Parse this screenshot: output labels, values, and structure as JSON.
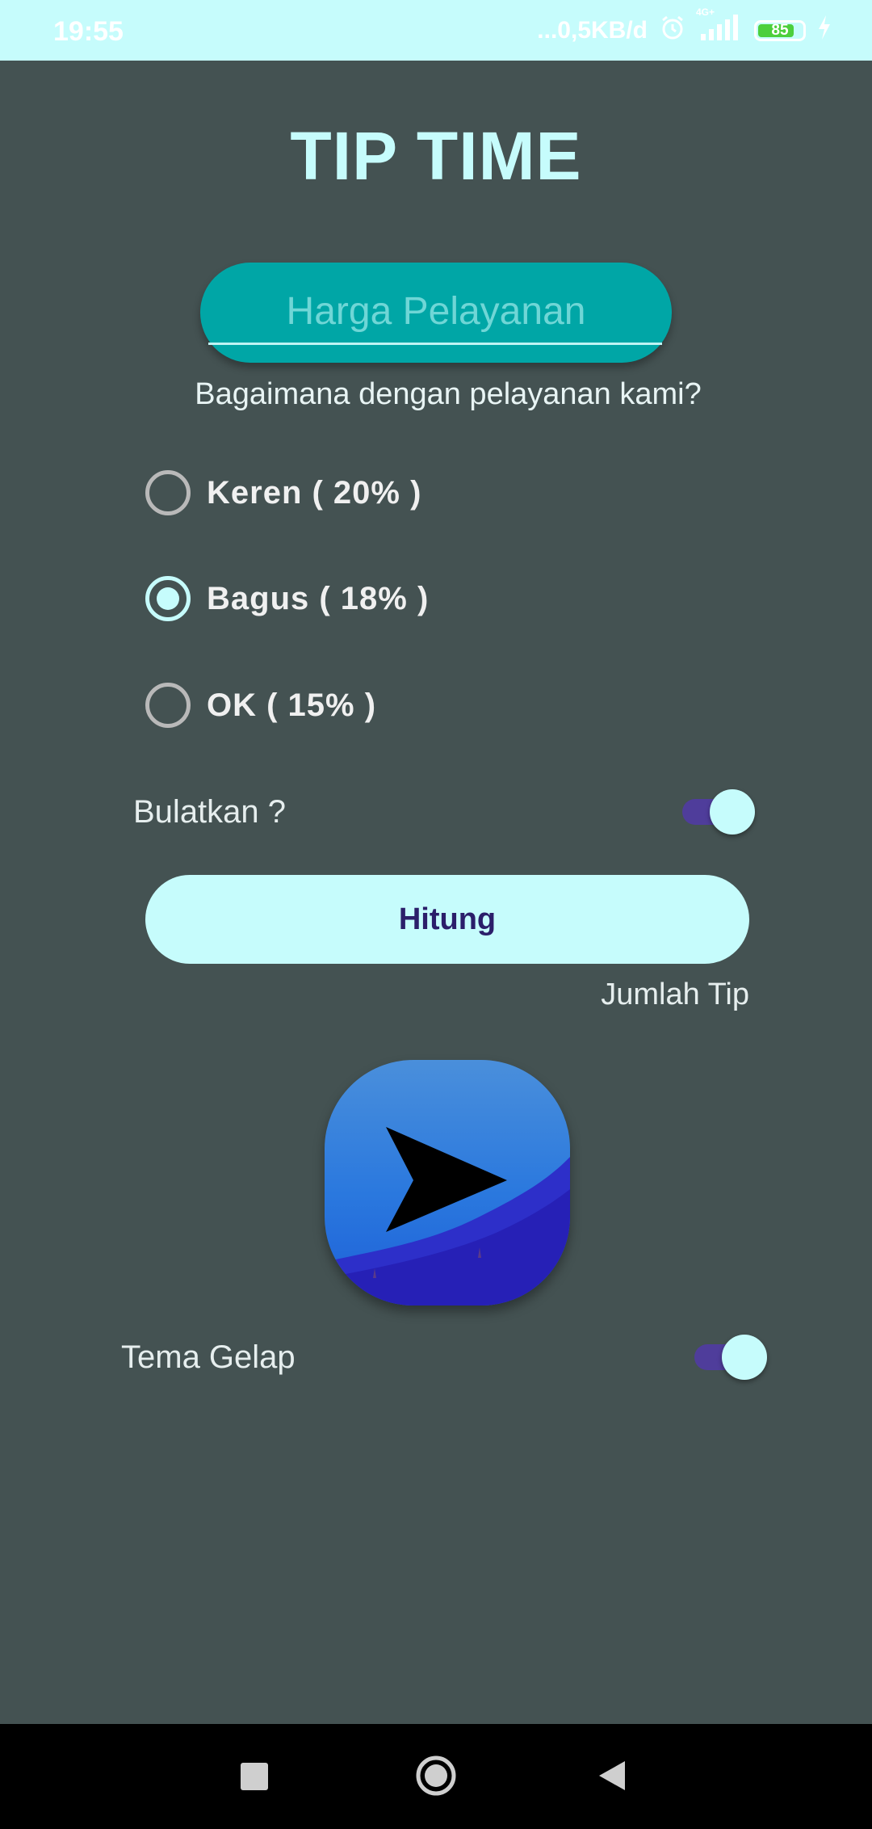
{
  "status_bar": {
    "time": "19:55",
    "network_speed": "...0,5KB/d",
    "battery": "85",
    "network_type": "4G+"
  },
  "app": {
    "title": "TIP TIME",
    "cost_input": {
      "placeholder": "Harga Pelayanan",
      "value": ""
    },
    "question": "Bagaimana dengan pelayanan kami?",
    "options": [
      {
        "label": "Keren ( 20% )",
        "selected": false
      },
      {
        "label": "Bagus ( 18% )",
        "selected": true
      },
      {
        "label": "OK ( 15% )",
        "selected": false
      }
    ],
    "round_up": {
      "label": "Bulatkan ?",
      "on": true
    },
    "calculate_button": "Hitung",
    "tip_amount_label": "Jumlah Tip",
    "dark_theme": {
      "label": "Tema Gelap",
      "on": true
    }
  },
  "colors": {
    "background": "#445252",
    "accent": "#c6fcfc",
    "input_bg": "#00a6a6",
    "switch_track": "#4f3d9b",
    "button_text": "#2b1e6a"
  },
  "icons": {
    "app_icon": "send-arrow-icon",
    "nav_recent": "square-icon",
    "nav_home": "circle-icon",
    "nav_back": "triangle-back-icon"
  }
}
